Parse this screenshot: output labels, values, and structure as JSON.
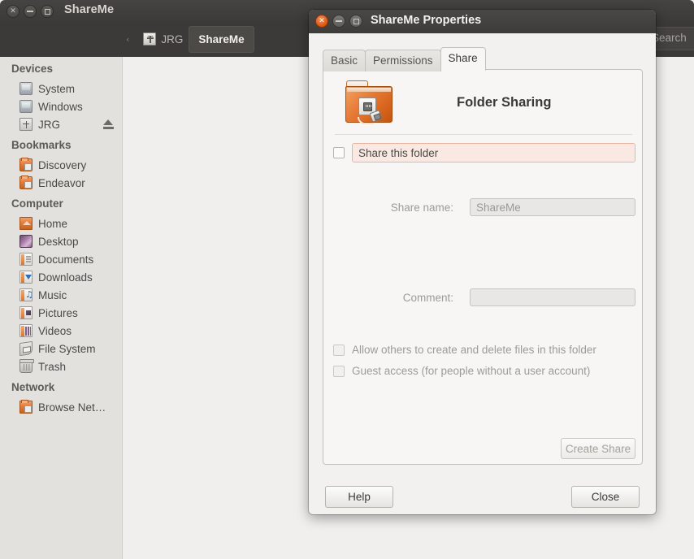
{
  "background_window": {
    "title": "ShareMe",
    "window_buttons": [
      {
        "name": "close",
        "glyph": "×"
      },
      {
        "name": "minimize",
        "glyph": "−"
      },
      {
        "name": "maximize",
        "glyph": "□"
      }
    ],
    "pathbar": {
      "overflow_arrow": "‹",
      "crumbs": [
        {
          "label": "JRG",
          "icon": "usb-drive-icon",
          "selected": false
        },
        {
          "label": "ShareMe",
          "icon": "",
          "selected": true
        }
      ]
    },
    "search": {
      "value": "Search"
    },
    "sidebar": {
      "sections": [
        {
          "header": "Devices",
          "items": [
            {
              "label": "System",
              "icon": "hard-drive-icon",
              "eject": false
            },
            {
              "label": "Windows",
              "icon": "hard-drive-icon",
              "eject": false
            },
            {
              "label": "JRG",
              "icon": "usb-drive-icon",
              "eject": true
            }
          ]
        },
        {
          "header": "Bookmarks",
          "items": [
            {
              "label": "Discovery",
              "icon": "folder-icon",
              "eject": false
            },
            {
              "label": "Endeavor",
              "icon": "folder-icon",
              "eject": false
            }
          ]
        },
        {
          "header": "Computer",
          "items": [
            {
              "label": "Home",
              "icon": "home-folder-icon",
              "eject": false
            },
            {
              "label": "Desktop",
              "icon": "desktop-icon",
              "eject": false
            },
            {
              "label": "Documents",
              "icon": "documents-folder-icon",
              "eject": false
            },
            {
              "label": "Downloads",
              "icon": "downloads-folder-icon",
              "eject": false
            },
            {
              "label": "Music",
              "icon": "music-folder-icon",
              "eject": false
            },
            {
              "label": "Pictures",
              "icon": "pictures-folder-icon",
              "eject": false
            },
            {
              "label": "Videos",
              "icon": "videos-folder-icon",
              "eject": false
            },
            {
              "label": "File System",
              "icon": "file-system-icon",
              "eject": false
            },
            {
              "label": "Trash",
              "icon": "trash-icon",
              "eject": false
            }
          ]
        },
        {
          "header": "Network",
          "items": [
            {
              "label": "Browse Net…",
              "icon": "network-folder-icon",
              "eject": false
            }
          ]
        }
      ]
    }
  },
  "dialog": {
    "title": "ShareMe Properties",
    "window_buttons": [
      {
        "name": "close",
        "glyph": "×"
      },
      {
        "name": "minimize",
        "glyph": "−"
      },
      {
        "name": "maximize",
        "glyph": "□"
      }
    ],
    "tabs": [
      {
        "label": "Basic",
        "active": false
      },
      {
        "label": "Permissions",
        "active": false
      },
      {
        "label": "Share",
        "active": true
      }
    ],
    "share_tab": {
      "heading": "Folder Sharing",
      "heading_icon": "shared-folder-icon",
      "share_checkbox": {
        "label": "Share this folder",
        "checked": false,
        "highlight_bg": "#fae9e3",
        "highlight_border": "#e9b49f"
      },
      "share_name": {
        "label": "Share name:",
        "value": "ShareMe",
        "enabled": false
      },
      "comment": {
        "label": "Comment:",
        "value": "",
        "enabled": false
      },
      "options": [
        {
          "label": "Allow others to create and delete files in this folder",
          "checked": false,
          "enabled": false
        },
        {
          "label": "Guest access (for people without a user account)",
          "checked": false,
          "enabled": false
        }
      ],
      "create_share_button": {
        "label": "Create Share",
        "enabled": false
      }
    },
    "footer_buttons": [
      {
        "name": "help",
        "label": "Help"
      },
      {
        "name": "close",
        "label": "Close"
      }
    ]
  },
  "theme": {
    "titlebar_dark": "#3e3c3a",
    "sidebar_bg": "#e2e1de",
    "content_bg": "#f0efee",
    "accent_orange": "#e05c16",
    "highlight_pink": "#fae9e3"
  }
}
